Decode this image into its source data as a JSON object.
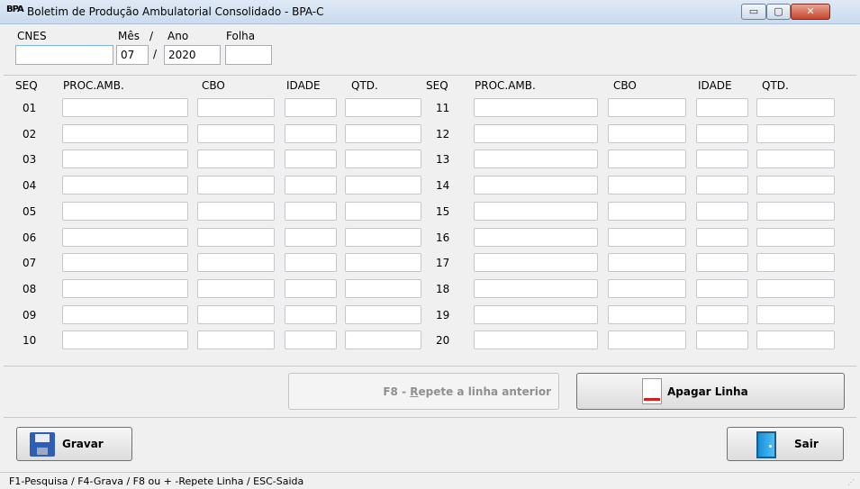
{
  "window": {
    "icon_text": "BPA",
    "title": "Boletim de Produção Ambulatorial Consolidado - BPA-C",
    "min_glyph": "▭",
    "max_glyph": "▢",
    "close_glyph": "✕"
  },
  "header": {
    "cnes_label": "CNES",
    "mes_label": "Mês",
    "slash1": "/",
    "ano_label": "Ano",
    "folha_label": "Folha",
    "cnes_value": "",
    "mes_value": "07",
    "slash2": "/",
    "ano_value": "2020",
    "folha_value": ""
  },
  "grid": {
    "columns": [
      "SEQ",
      "PROC.AMB.",
      "CBO",
      "IDADE",
      "QTD."
    ],
    "left_seq": [
      "01",
      "02",
      "03",
      "04",
      "05",
      "06",
      "07",
      "08",
      "09",
      "10"
    ],
    "right_seq": [
      "11",
      "12",
      "13",
      "14",
      "15",
      "16",
      "17",
      "18",
      "19",
      "20"
    ]
  },
  "buttons": {
    "repete_prefix": "F8 - ",
    "repete_underlined": "R",
    "repete_rest": "epete a linha anterior",
    "apagar": "Apagar Linha",
    "gravar": "Gravar",
    "sair": "Sair"
  },
  "status": {
    "text": "F1-Pesquisa / F4-Grava / F8 ou + -Repete Linha  / ESC-Saida"
  },
  "colors": {
    "window_bg": "#f0f0f0",
    "titlebar": "#c9dbee",
    "close_button": "#c8452c"
  }
}
